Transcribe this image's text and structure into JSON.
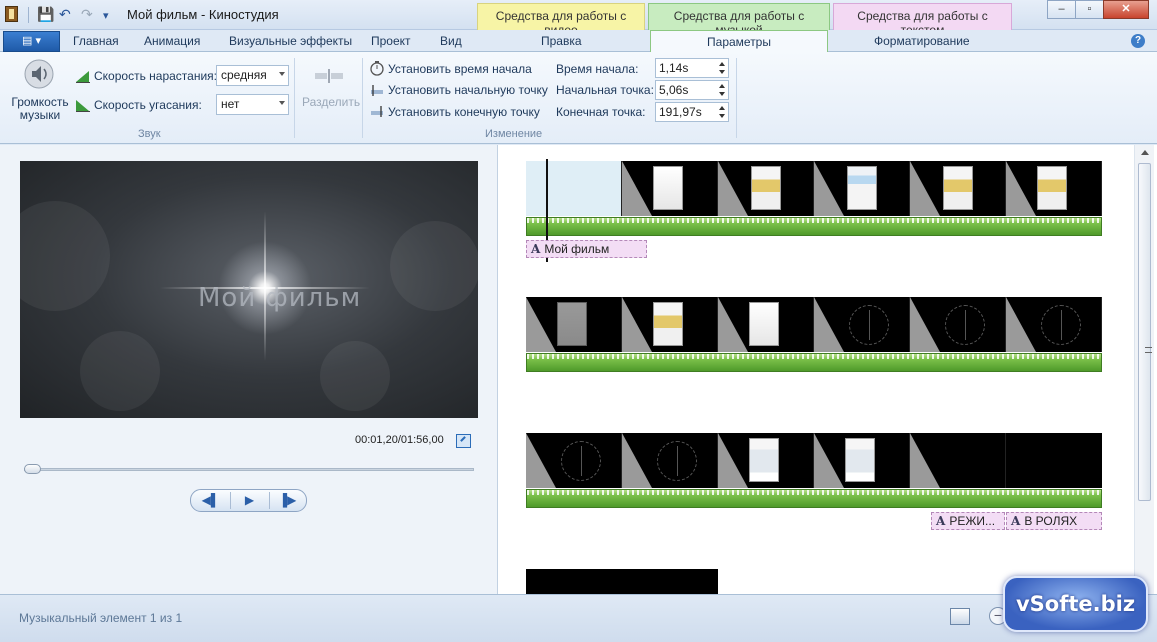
{
  "window": {
    "title": "Мой фильм - Киностудия",
    "qat": {
      "save": "💾",
      "undo": "↶",
      "redo": "↷",
      "customize": "▾"
    },
    "controls": {
      "minimize": "–",
      "maximize": "▫",
      "close": "✕"
    }
  },
  "context_tabs": {
    "video": "Средства для работы с видео",
    "music": "Средства для работы с музыкой",
    "text": "Средства для работы с текстом"
  },
  "tabs": {
    "file": "▤ ▾",
    "items": [
      "Главная",
      "Анимация",
      "Визуальные эффекты",
      "Проект",
      "Вид",
      "Правка",
      "Параметры",
      "Форматирование"
    ],
    "active": "Параметры",
    "help": "?"
  },
  "ribbon": {
    "sound": {
      "volume_label": "Громкость музыки",
      "fade_in_label": "Скорость нарастания:",
      "fade_in_value": "средняя",
      "fade_out_label": "Скорость угасания:",
      "fade_out_value": "нет",
      "group_label": "Звук"
    },
    "split": {
      "label": "Разделить"
    },
    "edit": {
      "set_start_time": "Установить время начала",
      "set_start_point": "Установить начальную точку",
      "set_end_point": "Установить конечную точку",
      "start_time_label": "Время начала:",
      "start_time_value": "1,14s",
      "start_point_label": "Начальная точка:",
      "start_point_value": "5,06s",
      "end_point_label": "Конечная точка:",
      "end_point_value": "191,97s",
      "group_label": "Изменение"
    }
  },
  "preview": {
    "title_overlay": "Мой фильм",
    "timecode": "00:01,20/01:56,00",
    "controls": {
      "prev": "◀▌",
      "play": "▶",
      "next": "▐▶"
    }
  },
  "storyboard": {
    "text_clips": {
      "title": "Мой фильм",
      "director": "РЕЖИ...",
      "cast": "В РОЛЯХ"
    }
  },
  "status": {
    "text": "Музыкальный элемент 1 из 1",
    "zoom_out": "−"
  },
  "watermark": "vSofte.biz"
}
